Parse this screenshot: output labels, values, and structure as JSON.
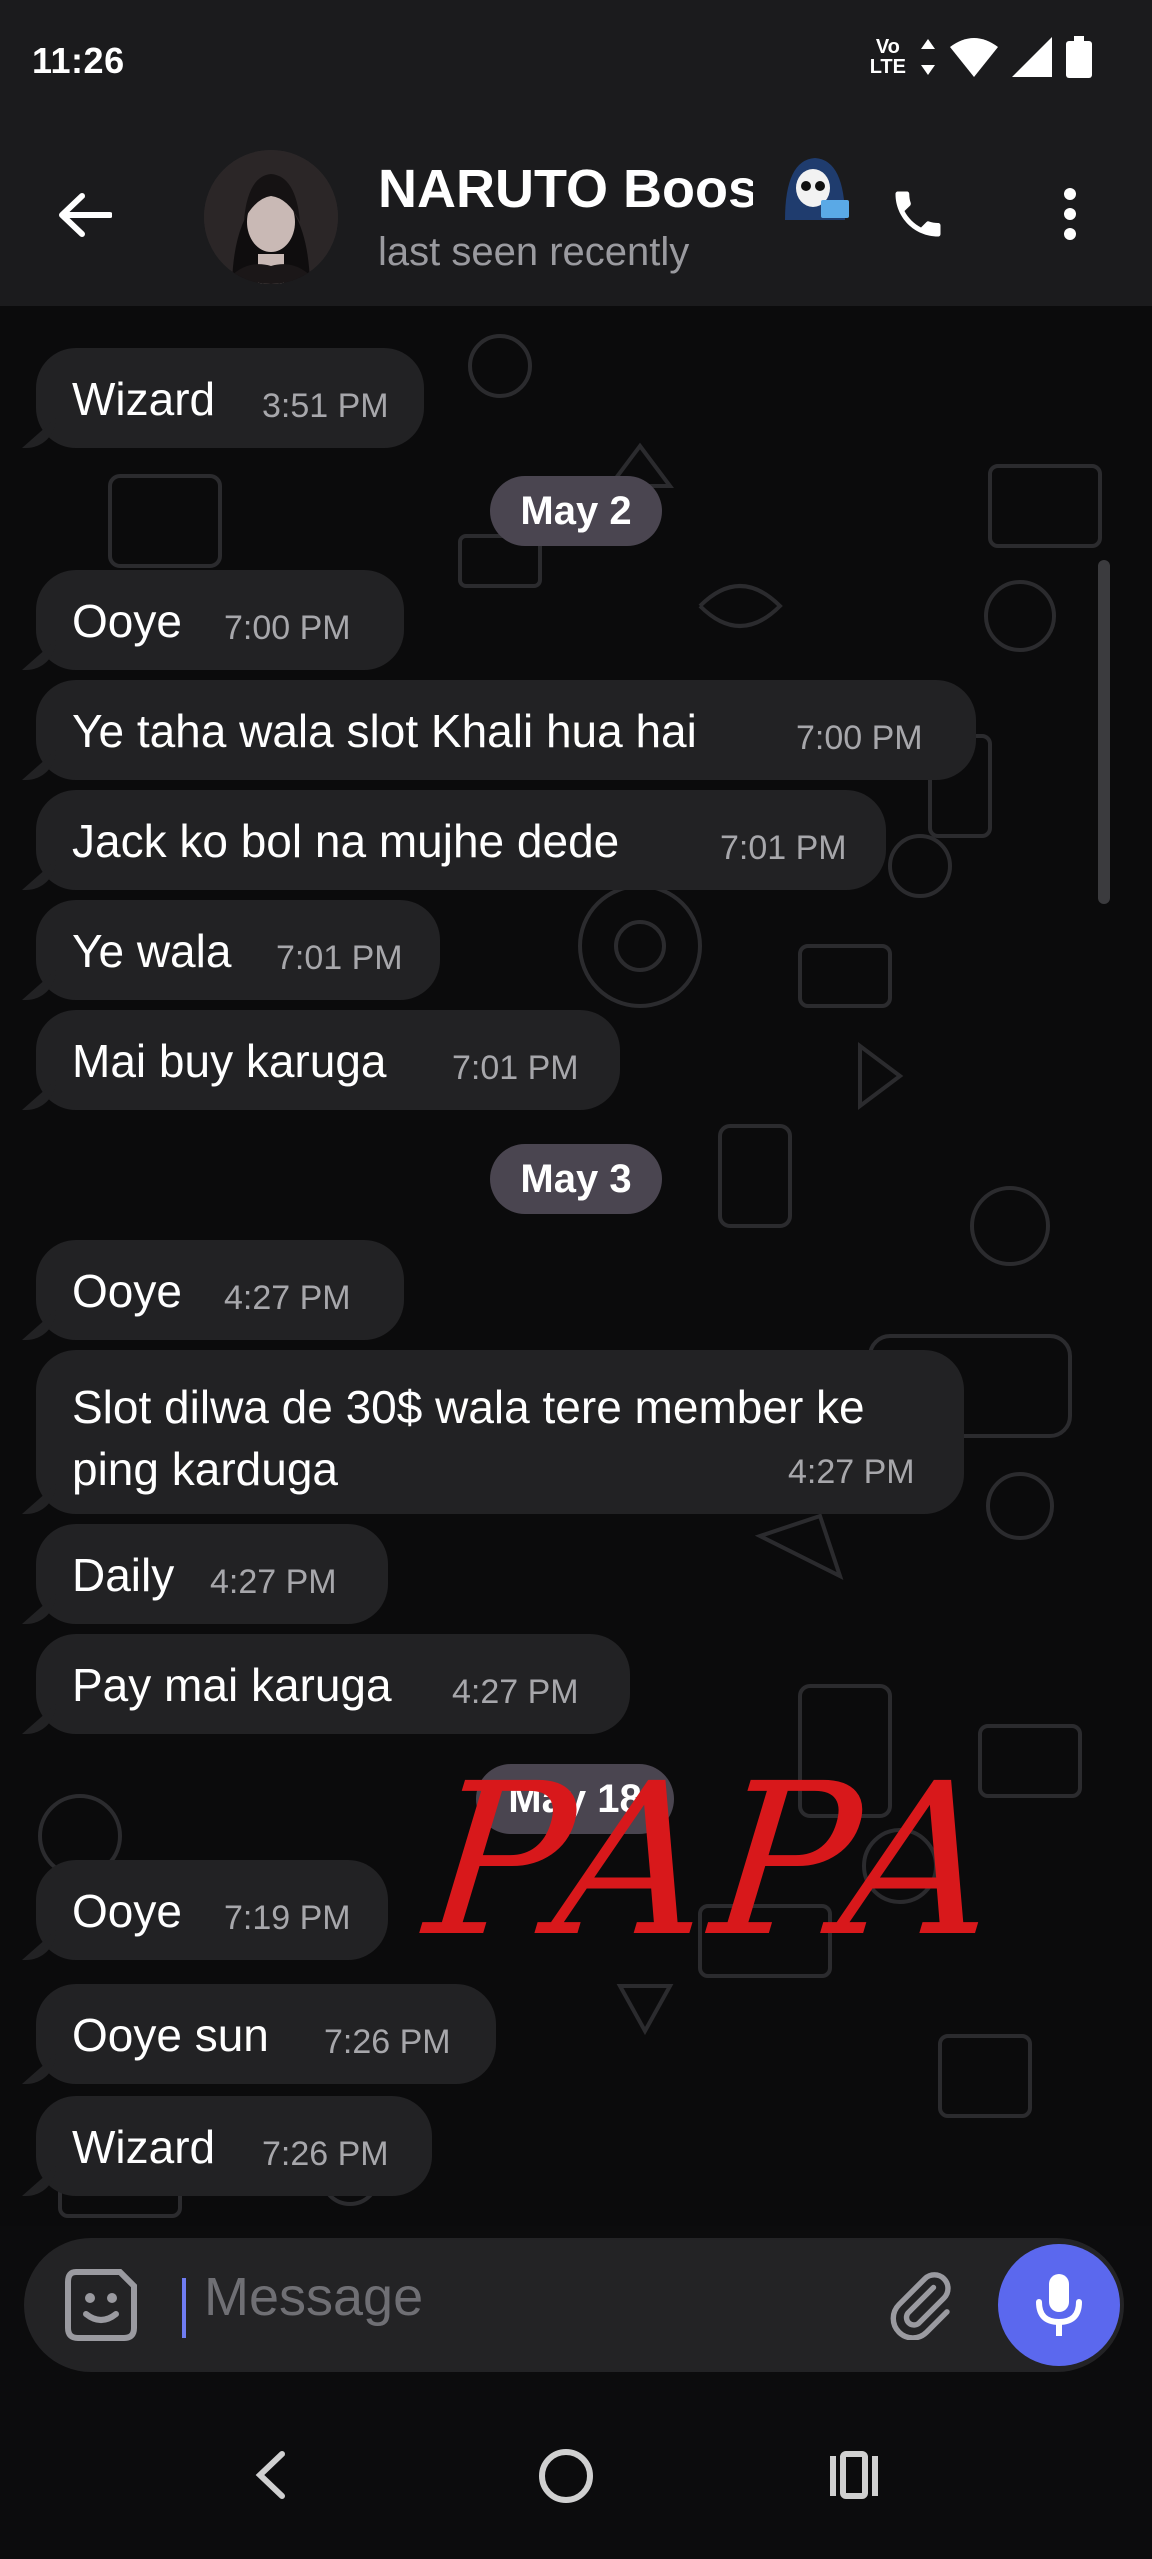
{
  "status_bar": {
    "time": "11:26",
    "volte_top": "Vo",
    "volte_bottom": "LTE"
  },
  "header": {
    "title": "NARUTO Boost",
    "subtitle": "last seen recently"
  },
  "messages": [
    {
      "text": "Wizard",
      "time": "3:51 PM"
    },
    {
      "date": "May 2"
    },
    {
      "text": "Ooye",
      "time": "7:00 PM"
    },
    {
      "text": "Ye taha wala slot Khali hua hai",
      "time": "7:00 PM"
    },
    {
      "text": "Jack ko bol na mujhe dede",
      "time": "7:01 PM"
    },
    {
      "text": "Ye wala",
      "time": "7:01 PM"
    },
    {
      "text": "Mai buy karuga",
      "time": "7:01 PM"
    },
    {
      "date": "May 3"
    },
    {
      "text": "Ooye",
      "time": "4:27 PM"
    },
    {
      "text": "Slot dilwa de 30$ wala tere member ke ping karduga",
      "time": "4:27 PM"
    },
    {
      "text": "Daily",
      "time": "4:27 PM"
    },
    {
      "text": "Pay mai karuga",
      "time": "4:27 PM"
    },
    {
      "date": "May 18"
    },
    {
      "text": "Ooye",
      "time": "7:19 PM"
    },
    {
      "text": "Ooye sun",
      "time": "7:26 PM"
    },
    {
      "text": "Wizard",
      "time": "7:26 PM"
    }
  ],
  "overlay": {
    "handwriting": "PAPA",
    "color": "#d8181b"
  },
  "composer": {
    "placeholder": "Message"
  },
  "colors": {
    "bubble": "#222224",
    "accent": "#5b68ee",
    "date_chip": "#4a4550"
  },
  "icons": [
    "back-arrow-icon",
    "phone-icon",
    "more-vert-icon",
    "sticker-icon",
    "paperclip-icon",
    "microphone-icon",
    "wifi-icon",
    "signal-icon",
    "battery-icon"
  ]
}
